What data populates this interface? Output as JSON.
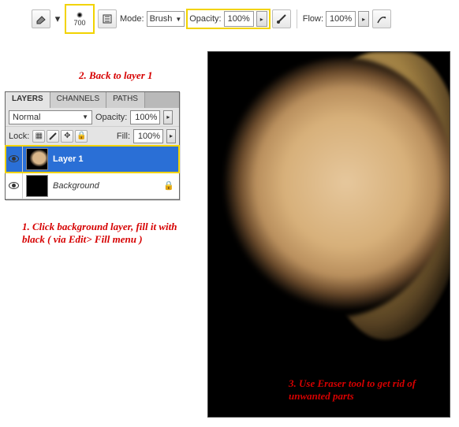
{
  "toolbar": {
    "brush_size": "700",
    "mode_label": "Mode:",
    "mode_value": "Brush",
    "opacity_label": "Opacity:",
    "opacity_value": "100%",
    "flow_label": "Flow:",
    "flow_value": "100%"
  },
  "annotations": {
    "step2": "2. Back to layer 1",
    "step1": "1. Click background layer, fill it with black ( via Edit> Fill menu )",
    "step3": "3. Use Eraser tool to get rid of unwanted parts"
  },
  "layers_panel": {
    "tabs": {
      "t0": "LAYERS",
      "t1": "CHANNELS",
      "t2": "PATHS"
    },
    "blend_mode": "Normal",
    "opacity_label": "Opacity:",
    "opacity_value": "100%",
    "lock_label": "Lock:",
    "fill_label": "Fill:",
    "fill_value": "100%",
    "layers": {
      "l0": {
        "name": "Layer 1"
      },
      "l1": {
        "name": "Background"
      }
    }
  },
  "colors": {
    "highlight": "#f2d300",
    "annotation": "#d60000",
    "selection": "#2a6fd6"
  }
}
